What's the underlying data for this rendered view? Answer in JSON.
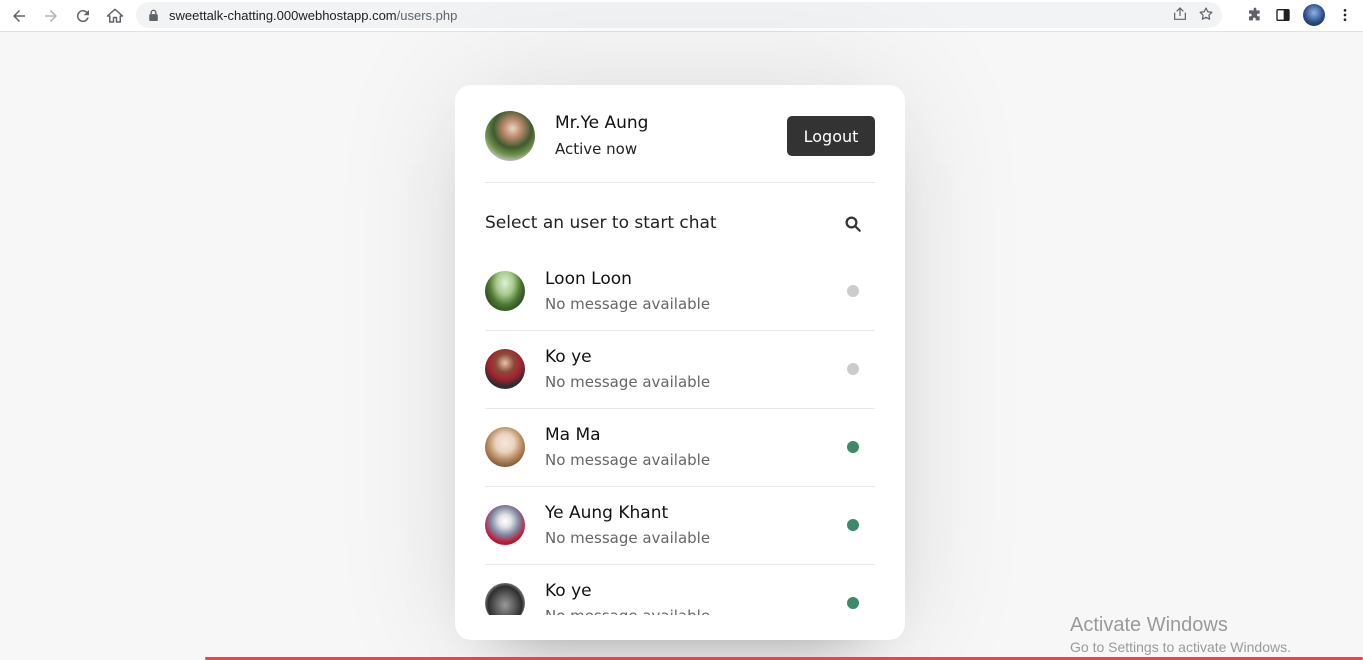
{
  "browser": {
    "url_host": "sweettalk-chatting.000webhostapp.com",
    "url_path": "/users.php"
  },
  "header": {
    "name": "Mr.Ye Aung",
    "status": "Active now",
    "logout_label": "Logout"
  },
  "search": {
    "text": "Select an user to start chat"
  },
  "users": [
    {
      "name": "Loon Loon",
      "message": "No message available",
      "online": false
    },
    {
      "name": "Ko ye",
      "message": "No message available",
      "online": false
    },
    {
      "name": "Ma Ma",
      "message": "No message available",
      "online": true
    },
    {
      "name": "Ye Aung Khant",
      "message": "No message available",
      "online": true
    },
    {
      "name": "Ko ye",
      "message": "No message available",
      "online": true
    }
  ],
  "colors": {
    "online": "#3c8a6a",
    "offline": "#cccccc",
    "button": "#333333"
  },
  "watermark": {
    "title": "Activate Windows",
    "subtitle": "Go to Settings to activate Windows."
  }
}
